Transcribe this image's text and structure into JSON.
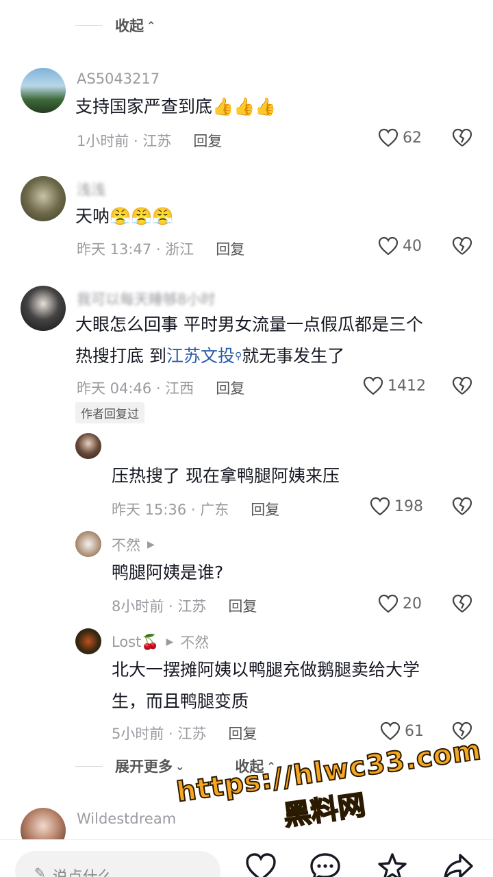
{
  "top": {
    "collapse_label": "收起"
  },
  "comments": [
    {
      "user": "AS5043217",
      "text": "支持国家严查到底👍👍👍",
      "time_loc": "1小时前 · 江苏",
      "reply": "回复",
      "likes": "62"
    },
    {
      "user": "浅浅",
      "text": "天呐😤😤😤",
      "time_loc": "昨天 13:47 · 浙江",
      "reply": "回复",
      "likes": "40"
    },
    {
      "user": "我可以每天睡够8小时",
      "text_a": "大眼怎么回事 平时男女流量一点假瓜都是三个",
      "text_b": "热搜打底 到",
      "text_link": "江苏文投",
      "text_c": "就无事发生了",
      "time_loc": "昨天 04:46 · 江西",
      "reply": "回复",
      "likes": "1412",
      "badge": "作者回复过"
    }
  ],
  "replies": [
    {
      "user": "",
      "text": "压热搜了 现在拿鸭腿阿姨来压",
      "time_loc": "昨天 15:36 · 广东",
      "reply": "回复",
      "likes": "198"
    },
    {
      "user": "不然",
      "text": "鸭腿阿姨是谁?",
      "time_loc": "8小时前 · 江苏",
      "reply": "回复",
      "likes": "20"
    },
    {
      "user": "Lost🍒",
      "reply_to": "不然",
      "text_a": "北大一摆摊阿姨以鸭腿充做鹅腿卖给大学",
      "text_b": "生，而且鸭腿变质",
      "time_loc": "5小时前 · 江苏",
      "reply": "回复",
      "likes": "61"
    }
  ],
  "thread_footer": {
    "expand_label": "展开更多",
    "collapse_label": "收起"
  },
  "next_comment": {
    "user": "Wildestdream"
  },
  "watermark": {
    "url": "https://hlwc33.com",
    "site": "黑料网"
  },
  "bottom_bar": {
    "placeholder": "说点什么",
    "icons": [
      "heart-icon",
      "comment-icon",
      "star-icon",
      "share-icon"
    ]
  },
  "colors": {
    "link": "#2a5ca8",
    "muted": "#9a9aa0",
    "text": "#161823"
  }
}
